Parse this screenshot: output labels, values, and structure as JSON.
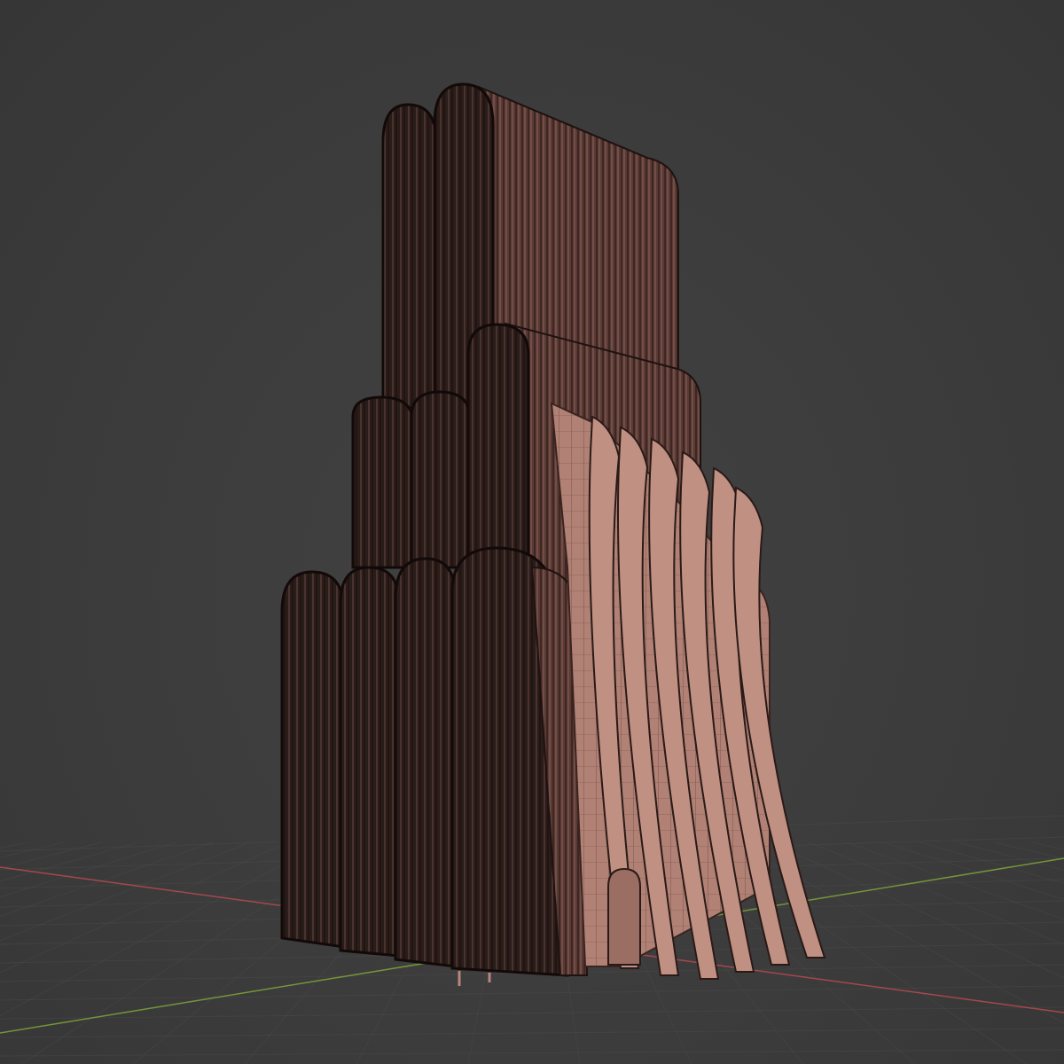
{
  "viewport": {
    "background_color": "#3d3d3d",
    "grid_color": "#4a4a4a",
    "x_axis_color": "#b84a52",
    "y_axis_color": "#7ea63a",
    "wire_color": "#1e1210",
    "surface_dark": "#2a1c19",
    "surface_light": "#b8867a",
    "surface_mid": "#8a625a"
  }
}
